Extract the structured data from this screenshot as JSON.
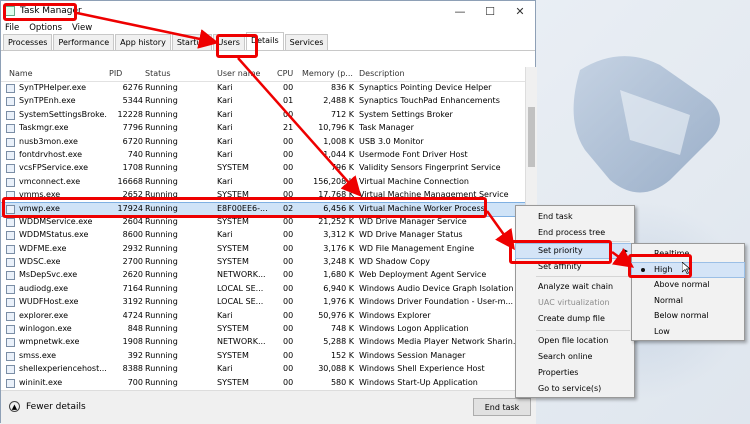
{
  "window": {
    "title": "Task Manager",
    "minimize": "—",
    "maximize": "☐",
    "close": "✕"
  },
  "menubar": [
    "File",
    "Options",
    "View"
  ],
  "tabs": [
    "Processes",
    "Performance",
    "App history",
    "Startup",
    "Users",
    "Details",
    "Services"
  ],
  "active_tab": "Details",
  "columns": [
    "Name",
    "PID",
    "Status",
    "User name",
    "CPU",
    "Memory (p...",
    "Description"
  ],
  "rows": [
    [
      "SynTPHelper.exe",
      "6276",
      "Running",
      "Kari",
      "00",
      "836 K",
      "Synaptics Pointing Device Helper"
    ],
    [
      "SynTPEnh.exe",
      "5344",
      "Running",
      "Kari",
      "01",
      "2,488 K",
      "Synaptics TouchPad Enhancements"
    ],
    [
      "SystemSettingsBroke...",
      "12228",
      "Running",
      "Kari",
      "00",
      "712 K",
      "System Settings Broker"
    ],
    [
      "Taskmgr.exe",
      "7796",
      "Running",
      "Kari",
      "21",
      "10,796 K",
      "Task Manager"
    ],
    [
      "nusb3mon.exe",
      "6720",
      "Running",
      "Kari",
      "00",
      "1,008 K",
      "USB 3.0 Monitor"
    ],
    [
      "fontdrvhost.exe",
      "740",
      "Running",
      "Kari",
      "00",
      "1,044 K",
      "Usermode Font Driver Host"
    ],
    [
      "vcsFPService.exe",
      "1708",
      "Running",
      "SYSTEM",
      "00",
      "796 K",
      "Validity Sensors Fingerprint Service"
    ],
    [
      "vmconnect.exe",
      "16668",
      "Running",
      "Kari",
      "00",
      "156,208 K",
      "Virtual Machine Connection"
    ],
    [
      "vmms.exe",
      "2652",
      "Running",
      "SYSTEM",
      "00",
      "17,768 K",
      "Virtual Machine Management Service"
    ],
    [
      "vmwp.exe",
      "17924",
      "Running",
      "E8F00EE6-...",
      "02",
      "6,456 K",
      "Virtual Machine Worker Process"
    ],
    [
      "WDDMService.exe",
      "2604",
      "Running",
      "SYSTEM",
      "00",
      "21,252 K",
      "WD Drive Manager Service"
    ],
    [
      "WDDMStatus.exe",
      "8600",
      "Running",
      "Kari",
      "00",
      "3,312 K",
      "WD Drive Manager Status"
    ],
    [
      "WDFME.exe",
      "2932",
      "Running",
      "SYSTEM",
      "00",
      "3,176 K",
      "WD File Management Engine"
    ],
    [
      "WDSC.exe",
      "2700",
      "Running",
      "SYSTEM",
      "00",
      "3,248 K",
      "WD Shadow Copy"
    ],
    [
      "MsDepSvc.exe",
      "2620",
      "Running",
      "NETWORK...",
      "00",
      "1,680 K",
      "Web Deployment Agent Service"
    ],
    [
      "audiodg.exe",
      "7164",
      "Running",
      "LOCAL SE...",
      "00",
      "6,940 K",
      "Windows Audio Device Graph Isolation"
    ],
    [
      "WUDFHost.exe",
      "3192",
      "Running",
      "LOCAL SE...",
      "00",
      "1,976 K",
      "Windows Driver Foundation - User-m..."
    ],
    [
      "explorer.exe",
      "4724",
      "Running",
      "Kari",
      "00",
      "50,976 K",
      "Windows Explorer"
    ],
    [
      "winlogon.exe",
      "848",
      "Running",
      "SYSTEM",
      "00",
      "748 K",
      "Windows Logon Application"
    ],
    [
      "wmpnetwk.exe",
      "1908",
      "Running",
      "NETWORK...",
      "00",
      "5,288 K",
      "Windows Media Player Network Sharin..."
    ],
    [
      "smss.exe",
      "392",
      "Running",
      "SYSTEM",
      "00",
      "152 K",
      "Windows Session Manager"
    ],
    [
      "shellexperiencehost....",
      "8388",
      "Running",
      "Kari",
      "00",
      "30,088 K",
      "Windows Shell Experience Host"
    ],
    [
      "wininit.exe",
      "700",
      "Running",
      "SYSTEM",
      "00",
      "580 K",
      "Windows Start-Up Application"
    ]
  ],
  "selected_row": "vmwp.exe",
  "footer": {
    "fewer": "Fewer details",
    "end_task": "End task"
  },
  "context_menu": {
    "items": [
      "End task",
      "End process tree",
      "Set priority",
      "Set affinity",
      "Analyze wait chain",
      "UAC virtualization",
      "Create dump file",
      "Open file location",
      "Search online",
      "Properties",
      "Go to service(s)"
    ],
    "disabled": [
      "UAC virtualization"
    ],
    "highlighted": "Set priority"
  },
  "priority_menu": {
    "items": [
      "Realtime",
      "High",
      "Above normal",
      "Normal",
      "Below normal",
      "Low"
    ],
    "selected": "High"
  },
  "colors": {
    "highlight": "#e00000",
    "selection": "#cfe3f7"
  }
}
